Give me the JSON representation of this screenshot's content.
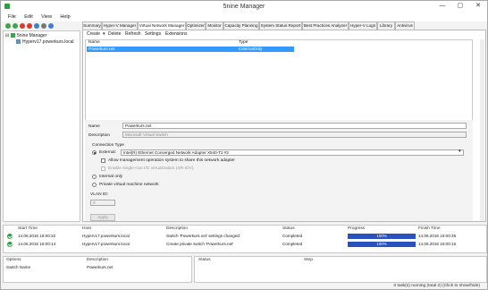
{
  "window": {
    "title": "5nine Manager",
    "controls": [
      "—",
      "▢",
      "✕"
    ]
  },
  "menu": [
    "File",
    "Edit",
    "View",
    "Help"
  ],
  "tree": {
    "root": "5nine Manager",
    "child": "Hyperv17.powerkurs.local"
  },
  "tabs": [
    "Summary",
    "Hyper-V Manager",
    "Virtual Network Manager",
    "Optimizer",
    "Monitor",
    "Capacity Planning",
    "System Status Report",
    "Best Practices Analyzer",
    "Hyper-V Logs",
    "Library",
    "Antivirus"
  ],
  "active_tab": "Virtual Network Manager",
  "subtoolbar": [
    "Create",
    "Delete",
    "Refresh",
    "Settings",
    "Extensions"
  ],
  "switch_grid": {
    "columns": [
      "Name",
      "Type"
    ],
    "rows": [
      {
        "name": "Powerkurs.net",
        "type": "ExternalOnly"
      }
    ]
  },
  "form": {
    "name_label": "Name",
    "name_value": "Powerkurs.net",
    "desc_label": "Description",
    "desc_value": "Microsoft Virtual Switch",
    "conn_type_label": "Connection Type",
    "external_label": "External:",
    "adapter_value": "Intel(R) Ethernet Converged Network Adapter X540-T2 #2",
    "allow_mgmt_label": "Allow management operation system to share this network adapter",
    "sriov_label": "Enable single-root I/O virtualization (SR-IOV)",
    "internal_label": "Internal only",
    "private_label": "Private virtual machine network",
    "vlan_label": "VLAN ID:",
    "vlan_value": "0",
    "apply_label": "Apply"
  },
  "tasks": {
    "columns": [
      "Start Time",
      "Host",
      "Description",
      "Status",
      "Progress",
      "Finish Time"
    ],
    "rows": [
      {
        "start": "14.06.2016 16:00:32",
        "host": "Hyperv17.powerkurs.local",
        "desc": "Switch 'Powerkurs.net' settings changed",
        "status": "Completed",
        "progress": "100%",
        "finish": "14.06.2016 16:00:35"
      },
      {
        "start": "14.06.2016 16:00:14",
        "host": "Hyperv17.powerkurs.local",
        "desc": "Create private switch 'Powerkurs.net'",
        "status": "Completed",
        "progress": "100%",
        "finish": "14.06.2016 16:00:15"
      }
    ]
  },
  "options_grid": {
    "columns": [
      "Options",
      "Description"
    ],
    "rows": [
      {
        "option": "Switch Name",
        "desc": "Powerkurs.net"
      }
    ]
  },
  "status_grid": {
    "columns": [
      "Status",
      "Step"
    ]
  },
  "statusbar_text": "0 task(s) running (total 2) (Click to show/hide)"
}
